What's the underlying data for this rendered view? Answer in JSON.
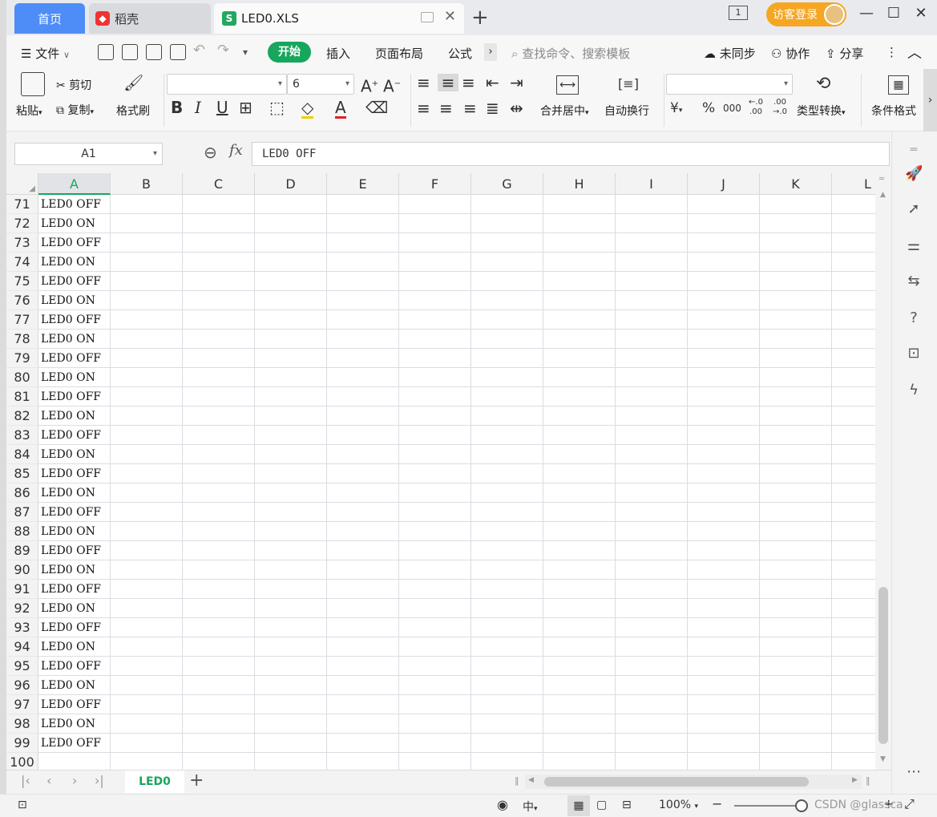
{
  "tabs": {
    "home": "首页",
    "daoke": "稻壳",
    "file": "LED0.XLS",
    "file_icon": "S",
    "new_tab": "+"
  },
  "titlebar": {
    "window_count": "1",
    "login": "访客登录"
  },
  "menu": {
    "file": "文件",
    "start": "开始",
    "insert": "插入",
    "page_layout": "页面布局",
    "formula": "公式",
    "search_placeholder": "查找命令、搜索模板",
    "unsynced": "未同步",
    "collab": "协作",
    "share": "分享"
  },
  "ribbon": {
    "paste": "粘贴",
    "cut": "剪切",
    "copy": "复制",
    "format_painter": "格式刷",
    "font_name": "",
    "font_size": "6",
    "merge_center": "合并居中",
    "auto_wrap": "自动换行",
    "number_format": "",
    "type_convert": "类型转换",
    "cond_format": "条件格式",
    "currency_symbol": "¥",
    "percent_symbol": "%",
    "thousands_symbol": "000",
    "dec_increase": "←.0 .00",
    "dec_decrease": ".00 →.0"
  },
  "formula_bar": {
    "cell_ref": "A1",
    "fx": "fx",
    "content": "LED0 OFF"
  },
  "columns": [
    "A",
    "B",
    "C",
    "D",
    "E",
    "F",
    "G",
    "H",
    "I",
    "J",
    "K",
    "L"
  ],
  "rows": [
    {
      "n": "71",
      "a": "LED0 OFF"
    },
    {
      "n": "72",
      "a": "LED0 ON"
    },
    {
      "n": "73",
      "a": "LED0 OFF"
    },
    {
      "n": "74",
      "a": "LED0 ON"
    },
    {
      "n": "75",
      "a": "LED0 OFF"
    },
    {
      "n": "76",
      "a": "LED0 ON"
    },
    {
      "n": "77",
      "a": "LED0 OFF"
    },
    {
      "n": "78",
      "a": "LED0 ON"
    },
    {
      "n": "79",
      "a": "LED0 OFF"
    },
    {
      "n": "80",
      "a": "LED0 ON"
    },
    {
      "n": "81",
      "a": "LED0 OFF"
    },
    {
      "n": "82",
      "a": "LED0 ON"
    },
    {
      "n": "83",
      "a": "LED0 OFF"
    },
    {
      "n": "84",
      "a": "LED0 ON"
    },
    {
      "n": "85",
      "a": "LED0 OFF"
    },
    {
      "n": "86",
      "a": "LED0 ON"
    },
    {
      "n": "87",
      "a": "LED0 OFF"
    },
    {
      "n": "88",
      "a": "LED0 ON"
    },
    {
      "n": "89",
      "a": "LED0 OFF"
    },
    {
      "n": "90",
      "a": "LED0 ON"
    },
    {
      "n": "91",
      "a": "LED0 OFF"
    },
    {
      "n": "92",
      "a": "LED0 ON"
    },
    {
      "n": "93",
      "a": "LED0 OFF"
    },
    {
      "n": "94",
      "a": "LED0 ON"
    },
    {
      "n": "95",
      "a": "LED0 OFF"
    },
    {
      "n": "96",
      "a": "LED0 ON"
    },
    {
      "n": "97",
      "a": "LED0 OFF"
    },
    {
      "n": "98",
      "a": "LED0 ON"
    },
    {
      "n": "99",
      "a": "LED0 OFF"
    },
    {
      "n": "100",
      "a": ""
    }
  ],
  "sheets": {
    "active": "LED0",
    "add": "+"
  },
  "status": {
    "zoom": "100%",
    "watermark": "CSDN @glassca"
  },
  "colors": {
    "accent": "#17a65d",
    "home_tab": "#4e8cf7",
    "login": "#f5a623"
  }
}
